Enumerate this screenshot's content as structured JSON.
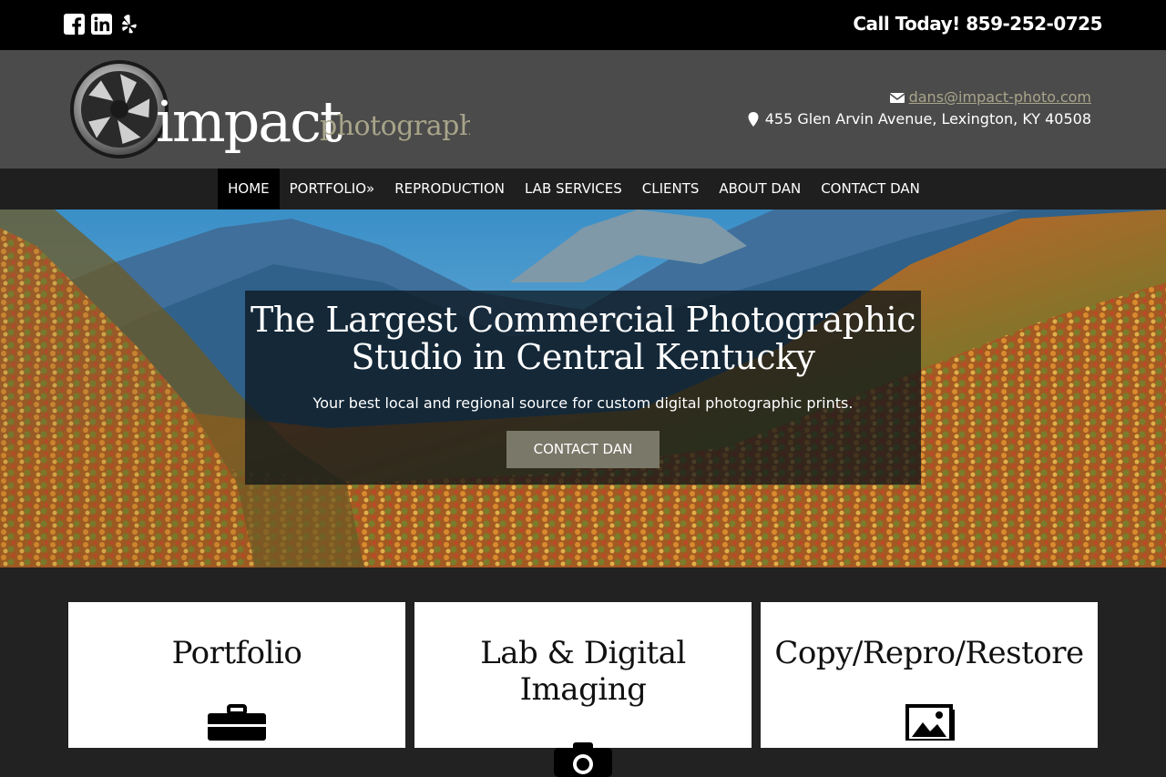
{
  "topbar": {
    "social_icons": [
      "facebook-icon",
      "linkedin-icon",
      "yelp-icon"
    ],
    "call_text": "Call Today! 859-252-0725"
  },
  "header": {
    "logo_text_main": "impact",
    "logo_text_sub": "photography",
    "email": "dans@impact-photo.com",
    "address": "455 Glen Arvin Avenue, Lexington, KY 40508"
  },
  "nav": {
    "items": [
      "HOME",
      "PORTFOLIO»",
      "REPRODUCTION",
      "LAB SERVICES",
      "CLIENTS",
      "ABOUT DAN",
      "CONTACT DAN"
    ],
    "active": "HOME"
  },
  "hero": {
    "title_line1": "The Largest Commercial Photographic",
    "title_line2": "Studio in Central Kentucky",
    "subtitle": "Your best local and regional source for custom digital photographic prints.",
    "button_label": "CONTACT DAN"
  },
  "cards": [
    {
      "title": "Portfolio",
      "icon": "briefcase-icon"
    },
    {
      "title": "Lab & Digital Imaging",
      "icon": "camera-icon"
    },
    {
      "title": "Copy/Repro/Restore",
      "icon": "picture-icon"
    }
  ],
  "colors": {
    "accent": "#7a7868",
    "link": "#a8a48a",
    "header_bg": "#4b4b4b",
    "nav_bg": "#1f1f1f"
  }
}
